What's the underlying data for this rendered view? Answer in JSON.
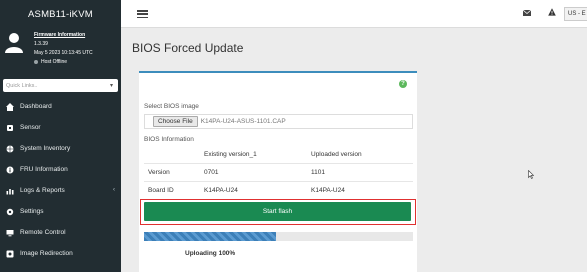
{
  "brand": {
    "title": "ASMB11-iKVM"
  },
  "user_panel": {
    "title": "Firmware Information",
    "version": "1.3.39",
    "date": "May 5 2023 10:13:45 UTC",
    "host_status": "Host Offline"
  },
  "search": {
    "placeholder": "Quick Links.."
  },
  "sidebar": {
    "items": [
      {
        "label": "Dashboard",
        "icon": "dashboard-icon"
      },
      {
        "label": "Sensor",
        "icon": "sensor-icon"
      },
      {
        "label": "System Inventory",
        "icon": "globe-icon"
      },
      {
        "label": "FRU Information",
        "icon": "info-icon"
      },
      {
        "label": "Logs & Reports",
        "icon": "chart-icon"
      },
      {
        "label": "Settings",
        "icon": "gear-icon"
      },
      {
        "label": "Remote Control",
        "icon": "monitor-icon"
      },
      {
        "label": "Image Redirection",
        "icon": "disc-icon"
      }
    ]
  },
  "topbar": {
    "language": "US - E"
  },
  "page": {
    "title": "BIOS Forced Update",
    "select_label": "Select BIOS image",
    "choose_file_label": "Choose File",
    "file_name": "K14PA-U24-ASUS-1101.CAP",
    "info_label": "BIOS Information",
    "table": {
      "headers": [
        "",
        "Existing version_1",
        "Uploaded version"
      ],
      "rows": [
        [
          "Version",
          "0701",
          "1101"
        ],
        [
          "Board ID",
          "K14PA-U24",
          "K14PA-U24"
        ]
      ]
    },
    "flash_button": "Start flash",
    "progress_fraction": 0.49,
    "upload_status": "Uploading 100%"
  },
  "colors": {
    "sidebar_bg": "#222d32",
    "accent": "#3c8dbc",
    "flash_button": "#1a8a52",
    "highlight_border": "#e03030"
  }
}
